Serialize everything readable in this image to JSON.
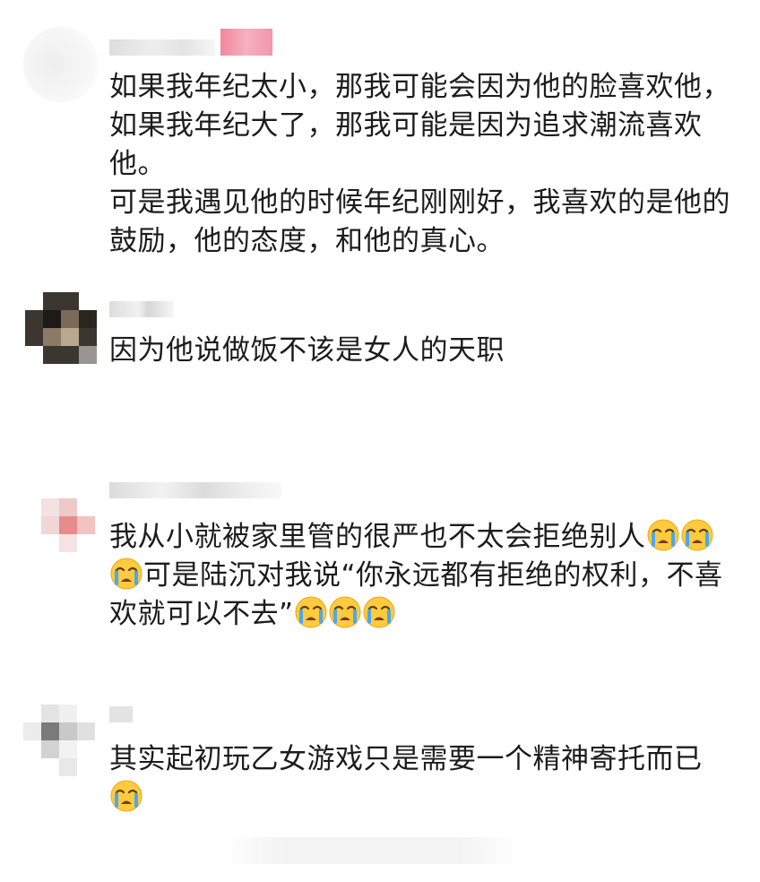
{
  "comments": [
    {
      "lines": [
        "如果我年纪太小，那我可能会因为他的脸喜欢他，",
        "如果我年纪大了，那我可能是因为追求潮流喜欢",
        "他。",
        "可是我遇见他的时候年纪刚刚好，我喜欢的是他的",
        "鼓励，他的态度，和他的真心。"
      ]
    },
    {
      "lines": [
        "因为他说做饭不该是女人的天职"
      ]
    },
    {
      "line1": "我从小就被家里管的很严也不太会拒绝别人",
      "line2": "可是陆沉对我说“你永远都有拒绝的权利，不喜",
      "line3": "欢就可以不去”"
    },
    {
      "line1": "其实起初玩乙女游戏只是需要一个精神寄托而已"
    }
  ],
  "icons": {
    "emoji": "loudly-crying-face-icon",
    "avatar": "blurred-avatar"
  },
  "colors": {
    "text": "#1c1c1c",
    "background": "#ffffff",
    "emoji_face": "#ffcb3d",
    "emoji_tear": "#4aa8ee"
  }
}
